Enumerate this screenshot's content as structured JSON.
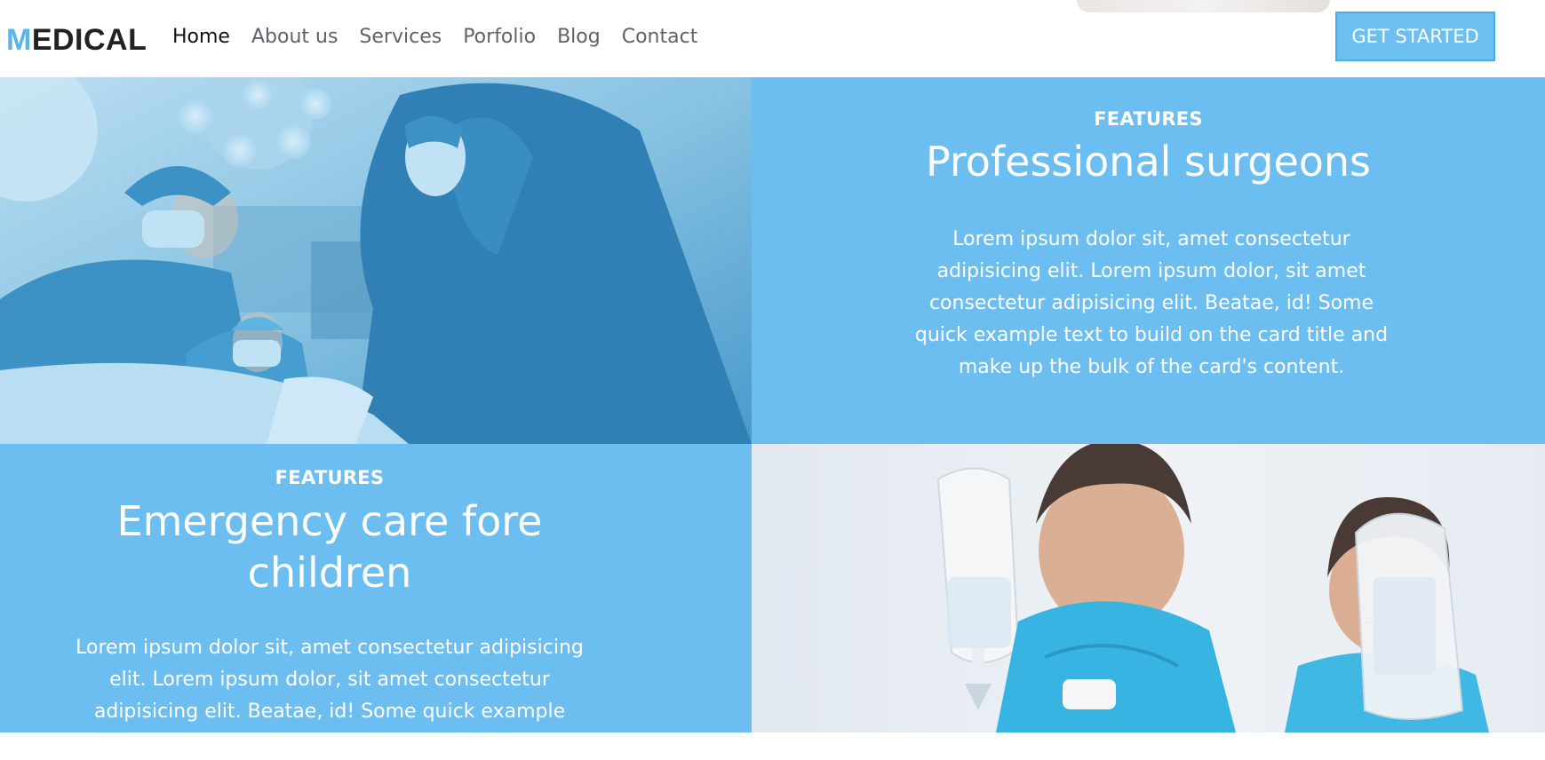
{
  "brand": {
    "logo_first": "M",
    "logo_rest": "EDICAL",
    "accent": "#5bb4ea"
  },
  "nav": {
    "items": [
      {
        "label": "Home",
        "active": true
      },
      {
        "label": "About us"
      },
      {
        "label": "Services"
      },
      {
        "label": "Porfolio"
      },
      {
        "label": "Blog"
      },
      {
        "label": "Contact"
      }
    ],
    "cta_label": "GET STARTED"
  },
  "features": [
    {
      "eyebrow": "FEATURES",
      "title": "Professional surgeons",
      "body": "Lorem ipsum dolor sit, amet consectetur adipisicing elit. Lorem ipsum dolor, sit amet consectetur adipisicing elit. Beatae, id! Some quick example text to build on the card title and make up the bulk of the card's content."
    },
    {
      "eyebrow": "FEATURES",
      "title": "Emergency care fore children",
      "body": "Lorem ipsum dolor sit, amet consectetur adipisicing elit. Lorem ipsum dolor, sit amet consectetur adipisicing elit. Beatae, id! Some quick example text to"
    }
  ],
  "colors": {
    "panel": "#6dbef0",
    "cta_bg": "#6dbff0",
    "cta_border": "#4aaee6",
    "text_dark": "#111111",
    "nav_text": "#5f6368"
  }
}
